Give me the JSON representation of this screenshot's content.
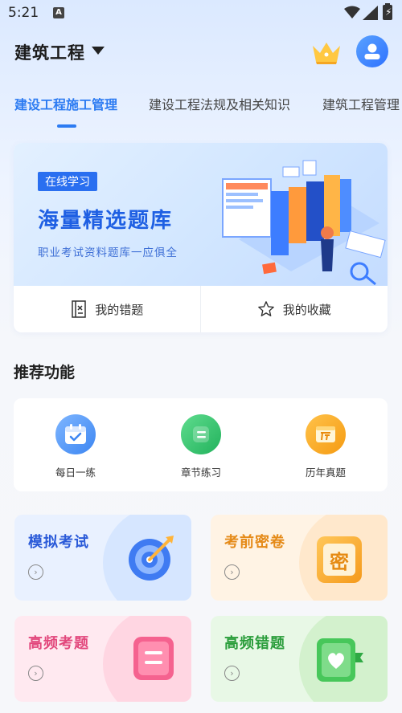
{
  "status_bar": {
    "time": "5:21",
    "notification_glyph": "A"
  },
  "header": {
    "course_title": "建筑工程",
    "crown_icon": "crown-icon",
    "avatar_icon": "user-icon"
  },
  "tabs": [
    {
      "label": "建设工程施工管理",
      "active": true
    },
    {
      "label": "建设工程法规及相关知识",
      "active": false
    },
    {
      "label": "建筑工程管理",
      "active": false
    }
  ],
  "banner": {
    "tag": "在线学习",
    "title": "海量精选题库",
    "subtitle": "职业考试资料题库一应俱全",
    "actions": [
      {
        "label": "我的错题",
        "icon": "wrong-list-icon"
      },
      {
        "label": "我的收藏",
        "icon": "star-icon"
      }
    ]
  },
  "recommend": {
    "title": "推荐功能",
    "items": [
      {
        "label": "每日一练",
        "icon": "calendar-check-icon",
        "color": "#4a8ff5"
      },
      {
        "label": "章节练习",
        "icon": "chapter-icon",
        "color": "#2ec06a"
      },
      {
        "label": "历年真题",
        "icon": "history-paper-icon",
        "color": "#f7a21a"
      }
    ]
  },
  "tiles": [
    {
      "title": "模拟考试",
      "icon": "target-icon",
      "color": "#2a5ad8",
      "bg": "#e6f0ff"
    },
    {
      "title": "考前密卷",
      "icon": "secret-paper-icon",
      "icon_text": "密",
      "color": "#e58a18",
      "bg": "#fff3e4"
    },
    {
      "title": "高频考题",
      "icon": "hot-question-icon",
      "color": "#e2477c",
      "bg": "#ffe8ef"
    },
    {
      "title": "高频错题",
      "icon": "heart-book-icon",
      "color": "#2a9d3b",
      "bg": "#e8f8e6"
    }
  ],
  "colors": {
    "accent": "#2c7bf2"
  }
}
